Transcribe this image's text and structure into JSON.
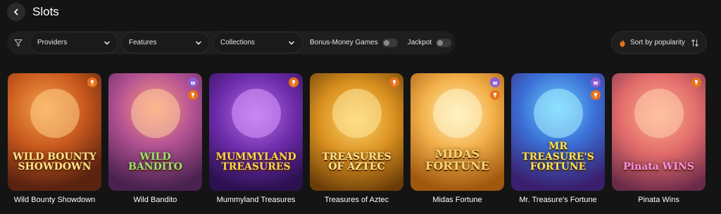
{
  "header": {
    "title": "Slots"
  },
  "filters": {
    "providers_label": "Providers",
    "features_label": "Features",
    "collections_label": "Collections",
    "bonus_money_label": "Bonus-Money Games",
    "jackpot_label": "Jackpot"
  },
  "sort": {
    "label": "Sort by popularity"
  },
  "games": [
    {
      "name": "Wild Bounty Showdown",
      "art_title": "WILD BOUNTY SHOWDOWN"
    },
    {
      "name": "Wild Bandito",
      "art_title": "WILD BANDITO"
    },
    {
      "name": "Mummyland Treasures",
      "art_title": "MUMMYLAND TREASURES"
    },
    {
      "name": "Treasures of Aztec",
      "art_title": "TREASURES OF AZTEC"
    },
    {
      "name": "Midas Fortune",
      "art_title": "MIDAS FORTUNE"
    },
    {
      "name": "Mr. Treasure's Fortune",
      "art_title": "MR TREASURE'S FORTUNE"
    },
    {
      "name": "Pinata Wins",
      "art_title": "Pinata WINS"
    }
  ],
  "colors": {
    "background": "#141414",
    "badge_trophy": "#e8721c",
    "badge_gift": "#8e5bd6",
    "sort_flame": "#e8721c"
  },
  "icons": {
    "back": "chevron-left-icon",
    "filter": "funnel-icon",
    "dropdown": "chevron-down-icon",
    "sort_flame": "flame-icon",
    "sort_direction": "sort-arrows-icon",
    "trophy": "trophy-icon",
    "gift": "gift-icon"
  }
}
